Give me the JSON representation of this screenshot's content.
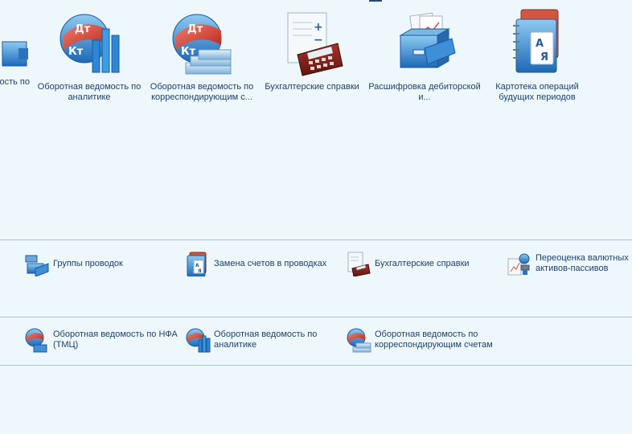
{
  "top_panel": {
    "items": [
      {
        "label": "ость по",
        "icon": "ledger-box-icon"
      },
      {
        "label": "Оборотная ведомость по аналитике",
        "icon": "dt-kt-chart-icon"
      },
      {
        "label": "Оборотная ведомость по корреспондирующим с...",
        "icon": "dt-kt-money-icon"
      },
      {
        "label": "Бухгалтерские справки",
        "icon": "calculator-document-icon"
      },
      {
        "label": "Расшифровка дебиторской и...",
        "icon": "file-box-icon"
      },
      {
        "label": "Картотека операций будущих периодов",
        "icon": "address-book-icon"
      }
    ]
  },
  "groups": [
    {
      "items": [
        {
          "label": "Группы проводок",
          "icon": "ledger-box-icon"
        },
        {
          "label": "Замена счетов в проводках",
          "icon": "address-book-icon"
        },
        {
          "label": "Бухгалтерские справки",
          "icon": "calculator-document-icon"
        },
        {
          "label": "Переоценка валютных активов-пассивов",
          "icon": "revaluation-icon"
        }
      ]
    },
    {
      "items": [
        {
          "label": "Оборотная ведомость по НФА (ТМЦ)",
          "icon": "dt-kt-box-icon"
        },
        {
          "label": "Оборотная ведомость по аналитике",
          "icon": "dt-kt-chart-icon"
        },
        {
          "label": "Оборотная ведомость по корреспондирующим счетам",
          "icon": "dt-kt-money-icon"
        }
      ]
    }
  ],
  "glyphs": {
    "dt": "Дт",
    "kt": "Кт",
    "book_a": "А",
    "book_ya": "Я"
  }
}
